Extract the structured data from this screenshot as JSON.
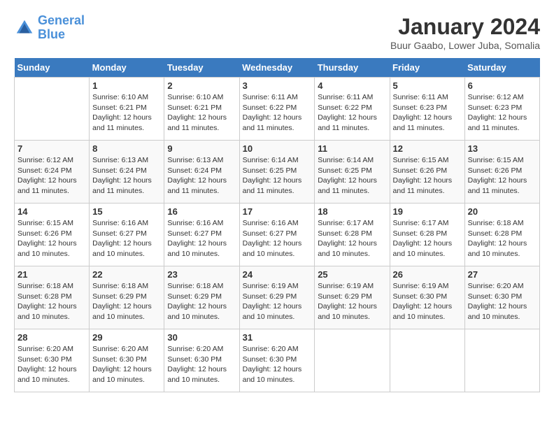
{
  "header": {
    "logo_general": "General",
    "logo_blue": "Blue",
    "month_title": "January 2024",
    "location": "Buur Gaabo, Lower Juba, Somalia"
  },
  "days_of_week": [
    "Sunday",
    "Monday",
    "Tuesday",
    "Wednesday",
    "Thursday",
    "Friday",
    "Saturday"
  ],
  "weeks": [
    [
      {
        "num": "",
        "detail": ""
      },
      {
        "num": "1",
        "detail": "Sunrise: 6:10 AM\nSunset: 6:21 PM\nDaylight: 12 hours\nand 11 minutes."
      },
      {
        "num": "2",
        "detail": "Sunrise: 6:10 AM\nSunset: 6:21 PM\nDaylight: 12 hours\nand 11 minutes."
      },
      {
        "num": "3",
        "detail": "Sunrise: 6:11 AM\nSunset: 6:22 PM\nDaylight: 12 hours\nand 11 minutes."
      },
      {
        "num": "4",
        "detail": "Sunrise: 6:11 AM\nSunset: 6:22 PM\nDaylight: 12 hours\nand 11 minutes."
      },
      {
        "num": "5",
        "detail": "Sunrise: 6:11 AM\nSunset: 6:23 PM\nDaylight: 12 hours\nand 11 minutes."
      },
      {
        "num": "6",
        "detail": "Sunrise: 6:12 AM\nSunset: 6:23 PM\nDaylight: 12 hours\nand 11 minutes."
      }
    ],
    [
      {
        "num": "7",
        "detail": "Sunrise: 6:12 AM\nSunset: 6:24 PM\nDaylight: 12 hours\nand 11 minutes."
      },
      {
        "num": "8",
        "detail": "Sunrise: 6:13 AM\nSunset: 6:24 PM\nDaylight: 12 hours\nand 11 minutes."
      },
      {
        "num": "9",
        "detail": "Sunrise: 6:13 AM\nSunset: 6:24 PM\nDaylight: 12 hours\nand 11 minutes."
      },
      {
        "num": "10",
        "detail": "Sunrise: 6:14 AM\nSunset: 6:25 PM\nDaylight: 12 hours\nand 11 minutes."
      },
      {
        "num": "11",
        "detail": "Sunrise: 6:14 AM\nSunset: 6:25 PM\nDaylight: 12 hours\nand 11 minutes."
      },
      {
        "num": "12",
        "detail": "Sunrise: 6:15 AM\nSunset: 6:26 PM\nDaylight: 12 hours\nand 11 minutes."
      },
      {
        "num": "13",
        "detail": "Sunrise: 6:15 AM\nSunset: 6:26 PM\nDaylight: 12 hours\nand 11 minutes."
      }
    ],
    [
      {
        "num": "14",
        "detail": "Sunrise: 6:15 AM\nSunset: 6:26 PM\nDaylight: 12 hours\nand 10 minutes."
      },
      {
        "num": "15",
        "detail": "Sunrise: 6:16 AM\nSunset: 6:27 PM\nDaylight: 12 hours\nand 10 minutes."
      },
      {
        "num": "16",
        "detail": "Sunrise: 6:16 AM\nSunset: 6:27 PM\nDaylight: 12 hours\nand 10 minutes."
      },
      {
        "num": "17",
        "detail": "Sunrise: 6:16 AM\nSunset: 6:27 PM\nDaylight: 12 hours\nand 10 minutes."
      },
      {
        "num": "18",
        "detail": "Sunrise: 6:17 AM\nSunset: 6:28 PM\nDaylight: 12 hours\nand 10 minutes."
      },
      {
        "num": "19",
        "detail": "Sunrise: 6:17 AM\nSunset: 6:28 PM\nDaylight: 12 hours\nand 10 minutes."
      },
      {
        "num": "20",
        "detail": "Sunrise: 6:18 AM\nSunset: 6:28 PM\nDaylight: 12 hours\nand 10 minutes."
      }
    ],
    [
      {
        "num": "21",
        "detail": "Sunrise: 6:18 AM\nSunset: 6:28 PM\nDaylight: 12 hours\nand 10 minutes."
      },
      {
        "num": "22",
        "detail": "Sunrise: 6:18 AM\nSunset: 6:29 PM\nDaylight: 12 hours\nand 10 minutes."
      },
      {
        "num": "23",
        "detail": "Sunrise: 6:18 AM\nSunset: 6:29 PM\nDaylight: 12 hours\nand 10 minutes."
      },
      {
        "num": "24",
        "detail": "Sunrise: 6:19 AM\nSunset: 6:29 PM\nDaylight: 12 hours\nand 10 minutes."
      },
      {
        "num": "25",
        "detail": "Sunrise: 6:19 AM\nSunset: 6:29 PM\nDaylight: 12 hours\nand 10 minutes."
      },
      {
        "num": "26",
        "detail": "Sunrise: 6:19 AM\nSunset: 6:30 PM\nDaylight: 12 hours\nand 10 minutes."
      },
      {
        "num": "27",
        "detail": "Sunrise: 6:20 AM\nSunset: 6:30 PM\nDaylight: 12 hours\nand 10 minutes."
      }
    ],
    [
      {
        "num": "28",
        "detail": "Sunrise: 6:20 AM\nSunset: 6:30 PM\nDaylight: 12 hours\nand 10 minutes."
      },
      {
        "num": "29",
        "detail": "Sunrise: 6:20 AM\nSunset: 6:30 PM\nDaylight: 12 hours\nand 10 minutes."
      },
      {
        "num": "30",
        "detail": "Sunrise: 6:20 AM\nSunset: 6:30 PM\nDaylight: 12 hours\nand 10 minutes."
      },
      {
        "num": "31",
        "detail": "Sunrise: 6:20 AM\nSunset: 6:30 PM\nDaylight: 12 hours\nand 10 minutes."
      },
      {
        "num": "",
        "detail": ""
      },
      {
        "num": "",
        "detail": ""
      },
      {
        "num": "",
        "detail": ""
      }
    ]
  ]
}
